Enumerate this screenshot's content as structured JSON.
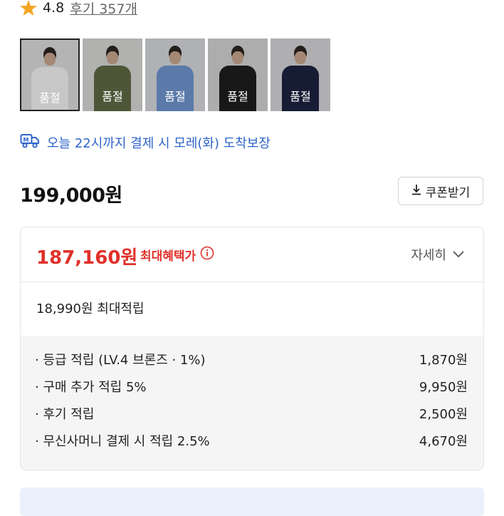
{
  "rating": {
    "value": "4.8",
    "reviews_label": "후기 357개",
    "star_color": "#f5a623"
  },
  "thumbnails": [
    {
      "status": "품절",
      "color": "#f3f3f3",
      "bg": "#dcdcdc",
      "selected": true
    },
    {
      "status": "품절",
      "color": "#5f6b45",
      "bg": "#d8d8d6",
      "selected": false
    },
    {
      "status": "품절",
      "color": "#6f95cf",
      "bg": "#d6d8dc",
      "selected": false
    },
    {
      "status": "품절",
      "color": "#1e1e1e",
      "bg": "#d4d4d4",
      "selected": false
    },
    {
      "status": "품절",
      "color": "#1c2340",
      "bg": "#d6d6d8",
      "selected": false
    }
  ],
  "delivery": {
    "text": "오늘 22시까지 결제 시 모레(화) 도착보장",
    "color": "#2f64c9"
  },
  "price": {
    "original": "199,000원"
  },
  "coupon": {
    "label": "쿠폰받기"
  },
  "benefit": {
    "max_price": "187,160원",
    "max_label": "최대혜택가",
    "details_label": "자세히",
    "points_total": "18,990원 최대적립",
    "items": [
      {
        "label": "· 등급 적립 (LV.4 브론즈 · 1%)",
        "value": "1,870원"
      },
      {
        "label": "· 구매 추가 적립 5%",
        "value": "9,950원"
      },
      {
        "label": "· 후기 적립",
        "value": "2,500원"
      },
      {
        "label": "· 무신사머니 결제 시 적립 2.5%",
        "value": "4,670원"
      }
    ],
    "accent_color": "#e0312a"
  }
}
